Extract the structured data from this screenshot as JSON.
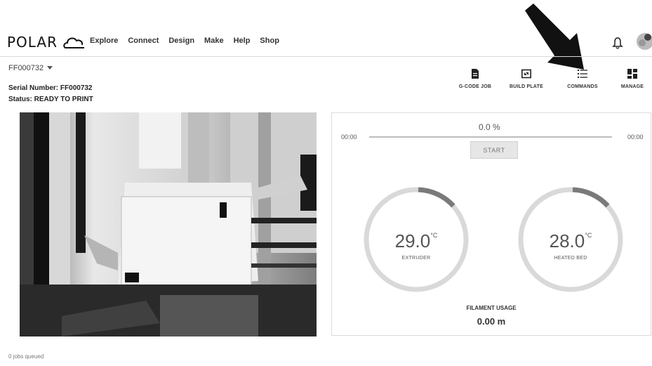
{
  "header": {
    "logo_text": "POLAR",
    "nav": [
      "Explore",
      "Connect",
      "Design",
      "Make",
      "Help",
      "Shop"
    ],
    "notification_icon": "bell-icon",
    "avatar_icon": "user-avatar-icon"
  },
  "printer": {
    "selected": "FF000732",
    "serial_line": "Serial Number: FF000732",
    "status_line": "Status: READY TO PRINT"
  },
  "toolbar": [
    {
      "label": "G-CODE JOB",
      "icon": "file-icon"
    },
    {
      "label": "BUILD PLATE",
      "icon": "build-plate-icon"
    },
    {
      "label": "COMMANDS",
      "icon": "list-icon"
    },
    {
      "label": "MANAGE",
      "icon": "grid-icon"
    }
  ],
  "job": {
    "progress_percent": 0.0,
    "percent_text": "0.0 %",
    "time_elapsed": "00:00",
    "time_remaining": "00:00",
    "start_label": "START"
  },
  "temperatures": {
    "extruder": {
      "value": "29.0",
      "unit": "°C",
      "label": "EXTRUDER"
    },
    "bed": {
      "value": "28.0",
      "unit": "°C",
      "label": "HEATED BED"
    }
  },
  "filament": {
    "label": "FILAMENT USAGE",
    "value": "0.00 m"
  },
  "footer": {
    "jobs_queued": "0 jobs queued"
  },
  "colors": {
    "gauge_track": "#d9d9d9",
    "gauge_fill": "#7a7a7a",
    "arrow": "#111111"
  }
}
